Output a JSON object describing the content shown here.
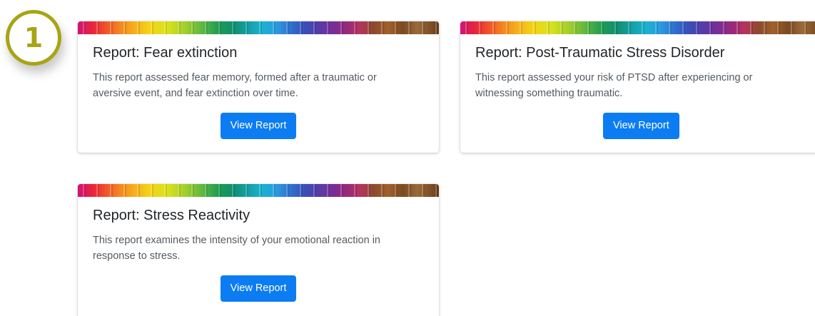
{
  "step_badge": {
    "number": "1"
  },
  "colors": {
    "badge": "#a8a414",
    "button": "#0c7cf2",
    "title": "#212529",
    "text": "#555b61"
  },
  "reports": [
    {
      "title": "Report: Fear extinction",
      "description_line1": "This report assessed fear memory, formed after a traumatic or",
      "description_line2": "aversive event, and fear extinction over time.",
      "button_label": "View Report"
    },
    {
      "title": "Report: Post-Traumatic Stress Disorder",
      "description_line1": "This report assessed your risk of PTSD after experiencing or",
      "description_line2": "witnessing something traumatic.",
      "button_label": "View Report"
    },
    {
      "title": "Report: Stress Reactivity",
      "description_line1": "This report examines the intensity of your emotional reaction in",
      "description_line2": "response to stress.",
      "button_label": "View Report"
    }
  ]
}
